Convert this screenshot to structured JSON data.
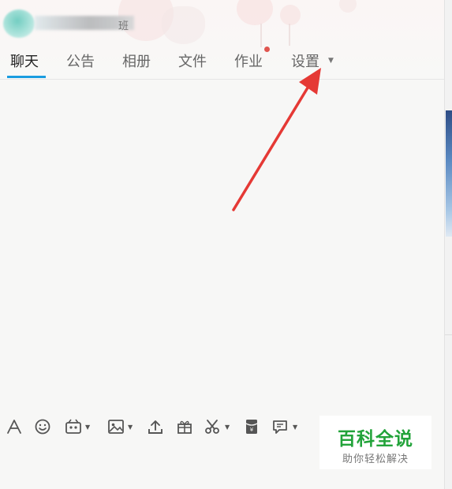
{
  "header": {
    "title_visible_fragment": "班"
  },
  "tabs": [
    {
      "label": "聊天",
      "active": true
    },
    {
      "label": "公告",
      "active": false
    },
    {
      "label": "相册",
      "active": false
    },
    {
      "label": "文件",
      "active": false
    },
    {
      "label": "作业",
      "active": false,
      "badge": "red-dot"
    },
    {
      "label": "设置",
      "active": false,
      "dropdown": true
    }
  ],
  "toolbar": {
    "icons": [
      "font-icon",
      "emoji-icon",
      "magic-expression-icon",
      "image-icon",
      "upload-file-icon",
      "gift-icon",
      "screenshot-scissors-icon",
      "red-packet-icon",
      "message-history-icon"
    ]
  },
  "watermark": {
    "title": "百科全说",
    "subtitle": "助你轻松解决"
  },
  "colors": {
    "tab_active_underline": "#1a9ce0",
    "notification_dot": "#e0554f",
    "annotation_arrow": "#e53935",
    "watermark_green": "#22a33a"
  }
}
